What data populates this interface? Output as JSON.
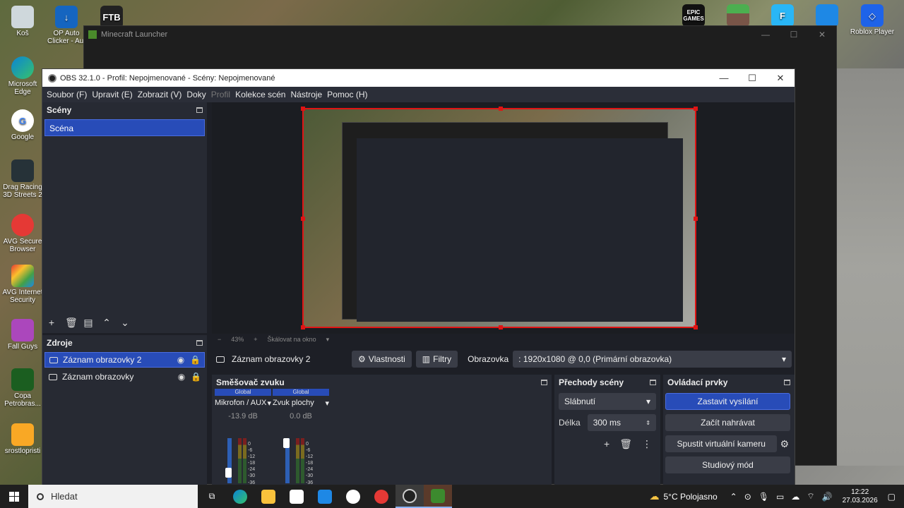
{
  "desktop": {
    "icons": [
      {
        "label": "Koš"
      },
      {
        "label": "OP Auto Clicker - Aut"
      },
      {
        "label": "FTB"
      },
      {
        "label": "Microsoft Edge"
      },
      {
        "label": "Google"
      },
      {
        "label": "Drag Racing 3D Streets 2"
      },
      {
        "label": "AVG Secure Browser"
      },
      {
        "label": "AVG Internet Security"
      },
      {
        "label": "Fall Guys"
      },
      {
        "label": "Copa Petrobras..."
      },
      {
        "label": "srostlopristi"
      },
      {
        "label": "EPIC GAMES"
      },
      {
        "label": "Roblox Player"
      }
    ]
  },
  "minecraft_window": {
    "title": "Minecraft Launcher"
  },
  "obs": {
    "title": "OBS 32.1.0 - Profil: Nepojmenované - Scény: Nepojmenované",
    "menu": [
      "Soubor (F)",
      "Upravit (E)",
      "Zobrazit (V)",
      "Doky",
      "Profil",
      "Kolekce scén",
      "Nástroje",
      "Pomoc (H)"
    ],
    "scenes": {
      "header": "Scény",
      "items": [
        "Scéna"
      ]
    },
    "sources": {
      "header": "Zdroje",
      "items": [
        "Záznam obrazovky 2",
        "Záznam obrazovky"
      ]
    },
    "zoom": {
      "level": "43%",
      "scale_label": "Škálovat na okno"
    },
    "context": {
      "source_name": "Záznam obrazovky 2",
      "properties": "Vlastnosti",
      "filters": "Filtry",
      "screen_label": "Obrazovka",
      "screen_value": ": 1920x1080 @ 0,0 (Primární obrazovka)"
    },
    "mixer": {
      "header": "Směšovač zvuku",
      "channels": [
        {
          "badge": "Global",
          "name": "Mikrofon / AUX",
          "db": "-13.9 dB"
        },
        {
          "badge": "Global",
          "name": "Zvuk plochy",
          "db": "0.0 dB"
        }
      ],
      "scale": [
        "0",
        "-6",
        "-12",
        "-18",
        "-24",
        "-30",
        "-36"
      ]
    },
    "transitions": {
      "header": "Přechody scény",
      "type": "Slábnutí",
      "duration_label": "Délka",
      "duration": "300 ms"
    },
    "controls": {
      "header": "Ovládací prvky",
      "stop_stream": "Zastavit vysílání",
      "start_record": "Začít nahrávat",
      "virtual_cam": "Spustit virtuální kameru",
      "studio_mode": "Studiový mód"
    }
  },
  "taskbar": {
    "search_placeholder": "Hledat",
    "weather": "5°C Polojasno",
    "time": "12:22",
    "date": "27.03.2026"
  },
  "colors": {
    "accent": "#284cb8",
    "selection_border": "#e01414"
  }
}
